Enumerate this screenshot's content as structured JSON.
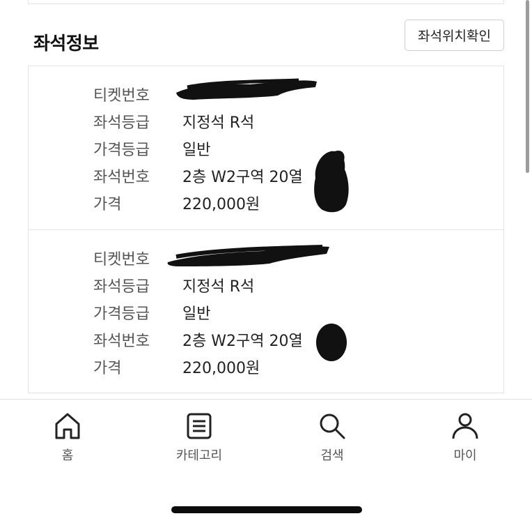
{
  "section": {
    "title": "좌석정보",
    "seat_map_button": "좌석위치확인"
  },
  "tickets": [
    {
      "rows": [
        {
          "label": "티켓번호",
          "value": ""
        },
        {
          "label": "좌석등급",
          "value": "지정석 R석"
        },
        {
          "label": "가격등급",
          "value": "일반"
        },
        {
          "label": "좌석번호",
          "value": "2층 W2구역 20열"
        },
        {
          "label": "가격",
          "value": "220,000원"
        }
      ]
    },
    {
      "rows": [
        {
          "label": "티켓번호",
          "value": ""
        },
        {
          "label": "좌석등급",
          "value": "지정석 R석"
        },
        {
          "label": "가격등급",
          "value": "일반"
        },
        {
          "label": "좌석번호",
          "value": "2층 W2구역 20열"
        },
        {
          "label": "가격",
          "value": "220,000원"
        }
      ]
    }
  ],
  "nav": [
    {
      "label": "홈",
      "icon": "home-icon"
    },
    {
      "label": "카테고리",
      "icon": "list-icon"
    },
    {
      "label": "검색",
      "icon": "search-icon"
    },
    {
      "label": "마이",
      "icon": "user-icon"
    }
  ],
  "colors": {
    "border": "#e3e3e3",
    "label": "#555555",
    "text": "#222222",
    "redaction": "#111111"
  }
}
